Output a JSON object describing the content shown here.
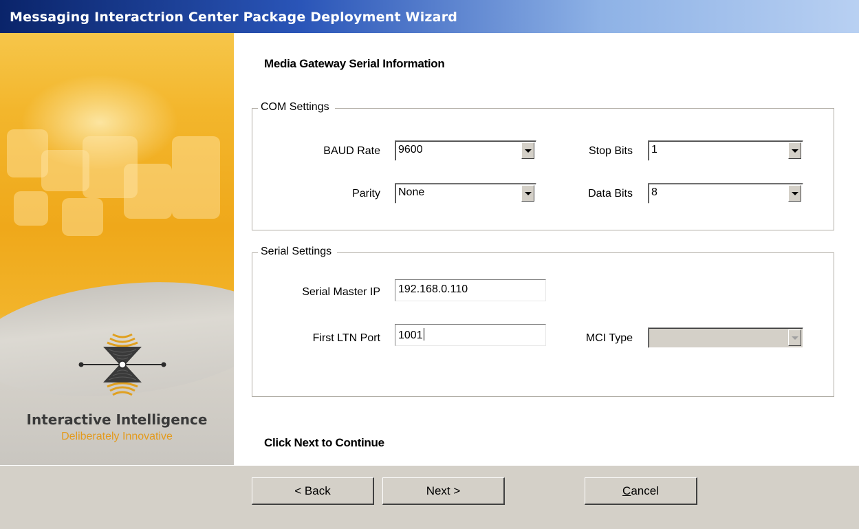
{
  "window": {
    "title": "Messaging Interactrion Center Package Deployment Wizard"
  },
  "sidebar": {
    "brand_name": "Interactive Intelligence",
    "tagline": "Deliberately Innovative",
    "logo_icon": "interactive-intelligence-logo-icon"
  },
  "page": {
    "heading": "Media Gateway Serial Information",
    "footer_text": "Click Next to Continue"
  },
  "com_settings": {
    "legend": "COM Settings",
    "baud_rate": {
      "label": "BAUD Rate",
      "value": "9600"
    },
    "stop_bits": {
      "label": "Stop Bits",
      "value": "1"
    },
    "parity": {
      "label": "Parity",
      "value": "None"
    },
    "data_bits": {
      "label": "Data Bits",
      "value": "8"
    }
  },
  "serial_settings": {
    "legend": "Serial Settings",
    "serial_master_ip": {
      "label": "Serial Master IP",
      "value": "192.168.0.110"
    },
    "first_ltn_port": {
      "label": "First LTN Port",
      "value": "1001"
    },
    "mci_type": {
      "label": "MCI Type",
      "value": ""
    }
  },
  "buttons": {
    "back": "< Back",
    "next": "Next >",
    "cancel_first": "C",
    "cancel_rest": "ancel"
  },
  "colors": {
    "title_start": "#0a246a",
    "title_end": "#b8d0f2",
    "panel_orange": "#efa81a",
    "tagline": "#e39a1c",
    "dialog_face": "#d4d0c8"
  }
}
